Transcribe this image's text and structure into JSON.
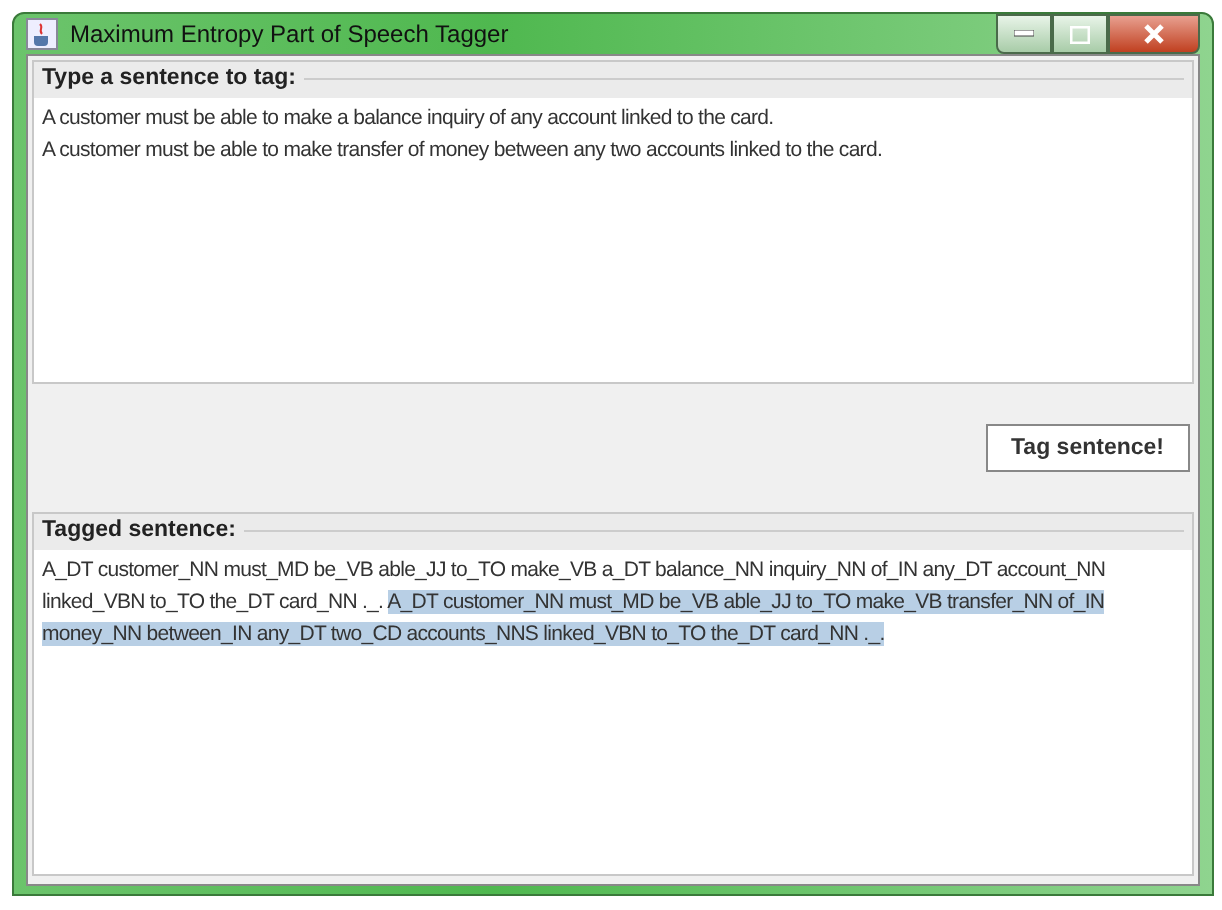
{
  "window": {
    "title": "Maximum Entropy Part of Speech Tagger"
  },
  "input": {
    "title": "Type a sentence to tag:",
    "lines": [
      "A customer must be able to make a balance inquiry of any account linked to the card.",
      "A customer must be able to make transfer of money between any two accounts linked to the card."
    ]
  },
  "button": {
    "label": "Tag sentence!"
  },
  "output": {
    "title": "Tagged sentence:",
    "lines": [
      [
        {
          "text": "A_DT customer_NN must_MD be_VB able_JJ to_TO make_VB a_DT balance_NN inquiry_NN of_IN any_DT account_NN",
          "selected": false
        }
      ],
      [
        {
          "text": "linked_VBN to_TO the_DT card_NN ._.",
          "selected": false
        },
        {
          "text": "A_DT customer_NN must_MD be_VB able_JJ to_TO make_VB transfer_NN of_IN",
          "selected": true
        }
      ],
      [
        {
          "text": "money_NN between_IN any_DT two_CD accounts_NNS linked_VBN to_TO the_DT card_NN ._.",
          "selected": true
        }
      ]
    ]
  }
}
